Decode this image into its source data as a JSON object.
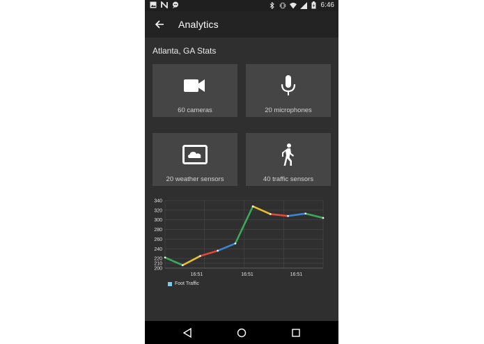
{
  "status_bar": {
    "time": "6:46",
    "left_icons": [
      "image-icon",
      "n-icon",
      "chat-icon"
    ],
    "right_icons": [
      "bluetooth-icon",
      "vibrate-icon",
      "wifi-icon",
      "signal-icon",
      "battery-icon"
    ]
  },
  "app_bar": {
    "title": "Analytics"
  },
  "stats": {
    "title": "Atlanta, GA Stats",
    "cards": [
      {
        "label": "60 cameras",
        "icon": "videocam-icon"
      },
      {
        "label": "20 microphones",
        "icon": "mic-icon"
      },
      {
        "label": "20 weather sensors",
        "icon": "cloud-screen-icon"
      },
      {
        "label": "40 traffic sensors",
        "icon": "walking-person-icon"
      }
    ]
  },
  "chart_data": {
    "type": "line",
    "x": [
      0,
      1,
      2,
      3,
      4,
      5,
      6,
      7,
      8,
      9
    ],
    "x_tick_labels": [
      "16:51",
      "16:51",
      "16:51"
    ],
    "series": [
      {
        "name": "Foot Traffic",
        "values": [
          222,
          206,
          225,
          236,
          251,
          328,
          312,
          308,
          313,
          304
        ]
      }
    ],
    "ylim": [
      200,
      340
    ],
    "yticks": [
      200,
      210,
      220,
      240,
      260,
      280,
      300,
      320,
      340
    ],
    "segment_colors": [
      "#3aaa5a",
      "#e7bf2a",
      "#e04a3a",
      "#3b86d0",
      "#3aaa5a",
      "#e7bf2a",
      "#e04a3a",
      "#3b86d0",
      "#3aaa5a"
    ],
    "legend_swatch_color": "#7ec9e8",
    "grid": true,
    "legend_position": "bottom-left"
  },
  "nav_bar": {
    "back": "back-triangle-icon",
    "home": "home-circle-icon",
    "recents": "recents-square-icon"
  }
}
